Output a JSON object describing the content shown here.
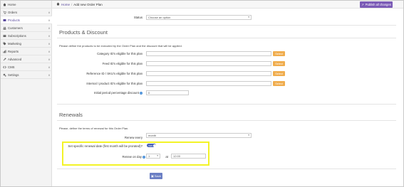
{
  "sidebar": {
    "items": [
      {
        "label": "Home",
        "icon": "home-icon",
        "chevron": false,
        "active": false
      },
      {
        "label": "Orders",
        "icon": "cart-icon",
        "chevron": true,
        "active": false
      },
      {
        "label": "Products",
        "icon": "box-icon",
        "chevron": true,
        "active": true
      },
      {
        "label": "Customers",
        "icon": "users-icon",
        "chevron": true,
        "active": false
      },
      {
        "label": "Subscriptions",
        "icon": "card-icon",
        "chevron": true,
        "active": false
      },
      {
        "label": "Marketing",
        "icon": "tag-icon",
        "chevron": true,
        "active": false
      },
      {
        "label": "Reports",
        "icon": "chart-icon",
        "chevron": true,
        "active": false
      },
      {
        "label": "Advanced",
        "icon": "wrench-icon",
        "chevron": true,
        "active": false
      },
      {
        "label": "CMS",
        "icon": "code-icon",
        "chevron": true,
        "active": false
      },
      {
        "label": "Settings",
        "icon": "gears-icon",
        "chevron": true,
        "active": false
      }
    ]
  },
  "topbar": {
    "breadcrumb": {
      "home": "Home",
      "separator": "/",
      "current": "Add new Order Plan"
    },
    "publish_label": "Publish all changes"
  },
  "form": {
    "status": {
      "label": "Status",
      "value": "Choose an option"
    },
    "products_section": {
      "title": "Products & Discount",
      "description": "Please define the products to be executed by the Order Plan and the discount that will be applied.",
      "fields": [
        {
          "label": "Category ID's eligible for this plan",
          "value": "",
          "button": "Select"
        },
        {
          "label": "Feed ID's eligible for this plan",
          "value": "",
          "button": "Select"
        },
        {
          "label": "Reference ID / SKU's eligible for this plan",
          "value": "",
          "button": "Select"
        },
        {
          "label": "Internal / product ID's eligible for this plan",
          "value": "",
          "button": "Select"
        }
      ],
      "initial_discount": {
        "label": "Initial period percentage discount",
        "value": "0"
      }
    },
    "renewals_section": {
      "title": "Renewals",
      "description": "Please, define the terms of renewal for this Order Plan.",
      "renew_every": {
        "label": "Renew every",
        "value": "month"
      },
      "specific_date": {
        "label": "Set specific renewal date (first month will be prorated)?",
        "toggle_text": "YES",
        "enabled": true
      },
      "renew_on_day": {
        "label": "Renew on day",
        "day_value": "1",
        "at_label": "at",
        "time_value": "12:00"
      }
    },
    "save_label": "Save"
  },
  "colors": {
    "accent": "#5a4a9c",
    "publish": "#7b5bb6",
    "select_button": "#f0ad4e",
    "highlight": "#f3f327",
    "save": "#6b7fc4"
  }
}
